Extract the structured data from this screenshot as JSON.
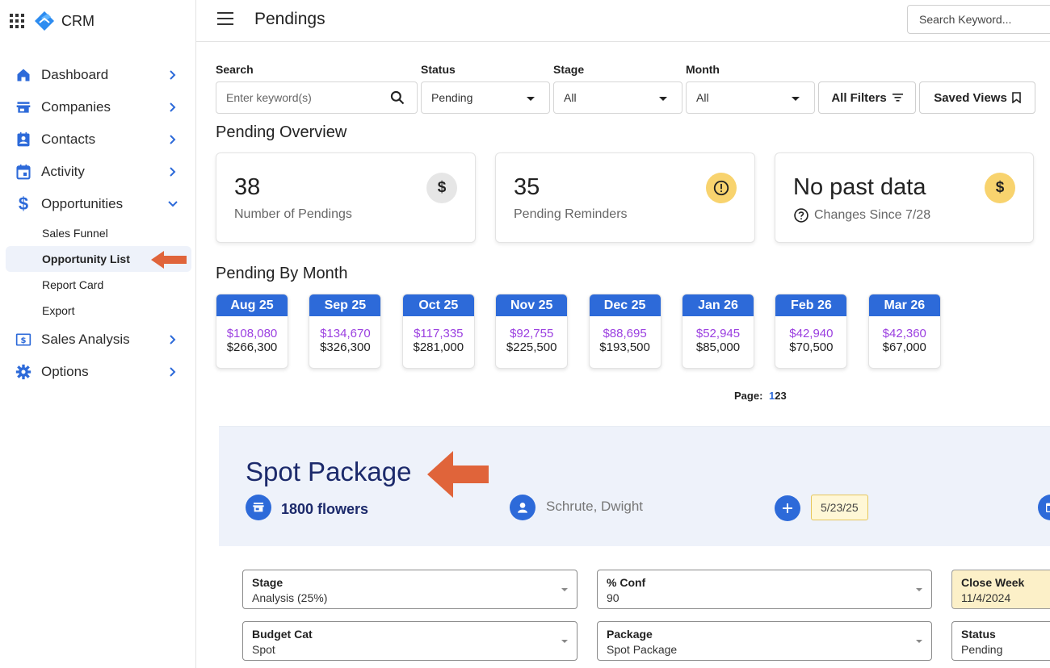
{
  "app": {
    "name": "CRM",
    "page_title": "Pendings"
  },
  "topbar": {
    "search_placeholder": "Search Keyword..."
  },
  "sidebar": {
    "items": [
      {
        "label": "Dashboard"
      },
      {
        "label": "Companies"
      },
      {
        "label": "Contacts"
      },
      {
        "label": "Activity"
      },
      {
        "label": "Opportunities"
      }
    ],
    "sub_items": [
      {
        "label": "Sales Funnel"
      },
      {
        "label": "Opportunity List"
      },
      {
        "label": "Report Card"
      },
      {
        "label": "Export"
      }
    ],
    "items_after": [
      {
        "label": "Sales Analysis"
      },
      {
        "label": "Options"
      }
    ]
  },
  "filters": {
    "search_label": "Search",
    "search_placeholder": "Enter keyword(s)",
    "status_label": "Status",
    "status_value": "Pending",
    "stage_label": "Stage",
    "stage_value": "All",
    "month_label": "Month",
    "month_value": "All",
    "all_filters": "All Filters",
    "saved_views": "Saved Views"
  },
  "overview": {
    "title": "Pending Overview",
    "cards": [
      {
        "value": "38",
        "label": "Number of Pendings"
      },
      {
        "value": "35",
        "label": "Pending Reminders"
      },
      {
        "value": "No past data",
        "label": "Changes Since 7/28"
      }
    ]
  },
  "by_month": {
    "title": "Pending By Month",
    "months": [
      {
        "month": "Aug 25",
        "v1": "$108,080",
        "v2": "$266,300"
      },
      {
        "month": "Sep 25",
        "v1": "$134,670",
        "v2": "$326,300"
      },
      {
        "month": "Oct 25",
        "v1": "$117,335",
        "v2": "$281,000"
      },
      {
        "month": "Nov 25",
        "v1": "$92,755",
        "v2": "$225,500"
      },
      {
        "month": "Dec 25",
        "v1": "$88,695",
        "v2": "$193,500"
      },
      {
        "month": "Jan 26",
        "v1": "$52,945",
        "v2": "$85,000"
      },
      {
        "month": "Feb 26",
        "v1": "$42,940",
        "v2": "$70,500"
      },
      {
        "month": "Mar 26",
        "v1": "$42,360",
        "v2": "$67,000"
      }
    ]
  },
  "pager": {
    "label": "Page:",
    "pages": [
      "1",
      "2",
      "3"
    ]
  },
  "detail": {
    "title": "Spot Package",
    "company": "1800 flowers",
    "person": "Schrute, Dwight",
    "date": "5/23/25",
    "fields": [
      {
        "label": "Stage",
        "value": "Analysis (25%)"
      },
      {
        "label": "% Conf",
        "value": "90"
      },
      {
        "label": "Close Week",
        "value": "11/4/2024"
      },
      {
        "label": "Budget Cat",
        "value": "Spot"
      },
      {
        "label": "Package",
        "value": "Spot Package"
      },
      {
        "label": "Status",
        "value": "Pending"
      }
    ]
  },
  "colors": {
    "primary": "#2d6ad9",
    "accent_purple": "#9b3fe0",
    "arrow": "#e0643a",
    "badge_yellow": "#f8d36e",
    "title_navy": "#1c2a6b"
  }
}
